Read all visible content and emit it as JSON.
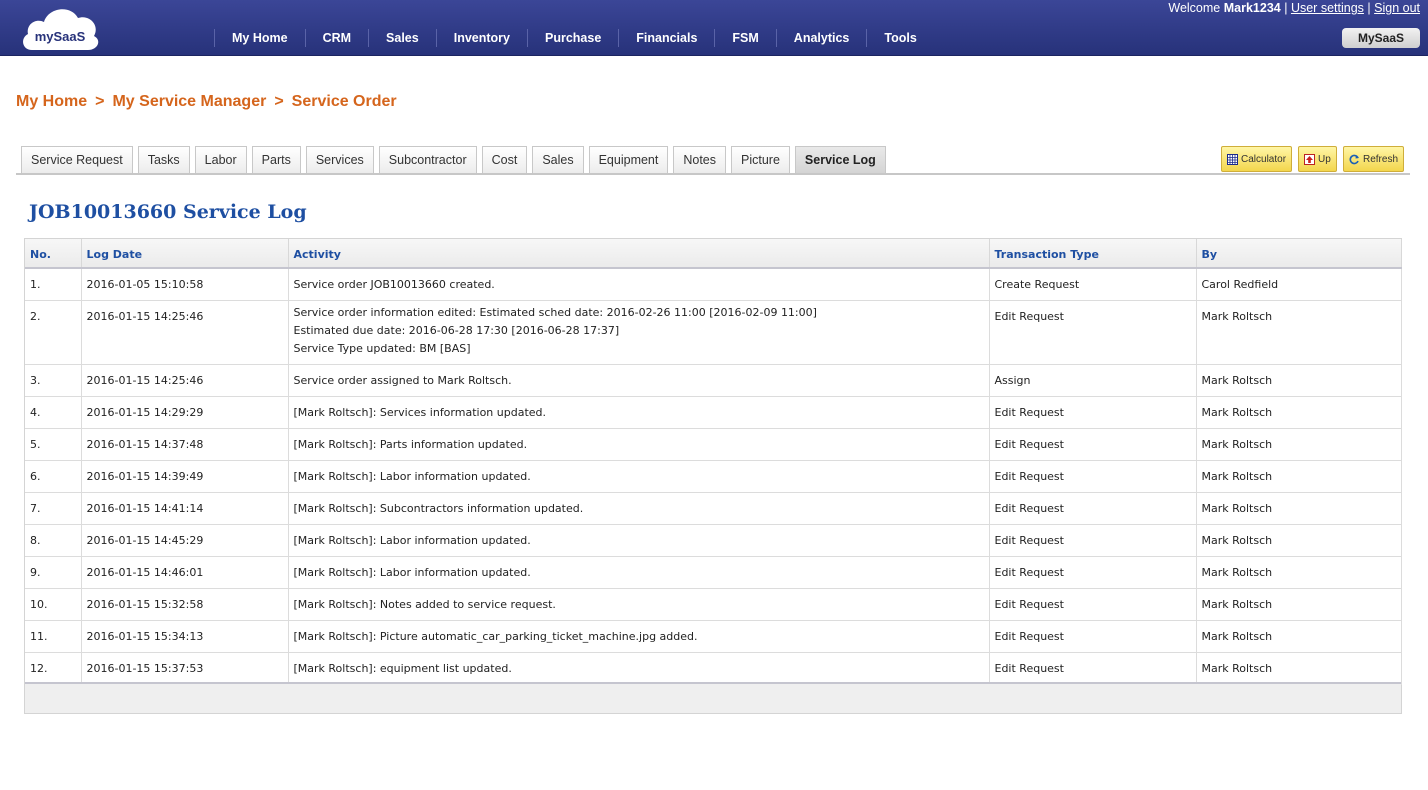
{
  "header": {
    "logo_text": "mySaaS",
    "nav": [
      "My Home",
      "CRM",
      "Sales",
      "Inventory",
      "Purchase",
      "Financials",
      "FSM",
      "Analytics",
      "Tools"
    ],
    "welcome_prefix": "Welcome",
    "username": "Mark1234",
    "separator": "|",
    "user_settings": "User settings",
    "sign_out": "Sign out",
    "mysaas_button": "MySaaS"
  },
  "breadcrumb": {
    "items": [
      "My Home",
      "My Service Manager",
      "Service Order"
    ],
    "separator": ">"
  },
  "tabs": [
    "Service Request",
    "Tasks",
    "Labor",
    "Parts",
    "Services",
    "Subcontractor",
    "Cost",
    "Sales",
    "Equipment",
    "Notes",
    "Picture",
    "Service Log"
  ],
  "active_tab": "Service Log",
  "toolbar": {
    "calculator": "Calculator",
    "up": "Up",
    "refresh": "Refresh"
  },
  "page_title": "JOB10013660 Service Log",
  "table": {
    "columns": [
      "No.",
      "Log Date",
      "Activity",
      "Transaction Type",
      "By"
    ],
    "rows": [
      {
        "no": "1.",
        "date": "2016-01-05 15:10:58",
        "activity": [
          "Service order JOB10013660 created."
        ],
        "type": "Create Request",
        "by": "Carol Redfield"
      },
      {
        "no": "2.",
        "date": "2016-01-15 14:25:46",
        "activity": [
          "Service order information edited: Estimated sched date: 2016-02-26 11:00 [2016-02-09 11:00]",
          "Estimated due date: 2016-06-28 17:30 [2016-06-28 17:37]",
          "Service Type updated: BM [BAS]"
        ],
        "type": "Edit Request",
        "by": "Mark Roltsch"
      },
      {
        "no": "3.",
        "date": "2016-01-15 14:25:46",
        "activity": [
          "Service order assigned to Mark Roltsch."
        ],
        "type": "Assign",
        "by": "Mark Roltsch"
      },
      {
        "no": "4.",
        "date": "2016-01-15 14:29:29",
        "activity": [
          "[Mark Roltsch]: Services information updated."
        ],
        "type": "Edit Request",
        "by": "Mark Roltsch"
      },
      {
        "no": "5.",
        "date": "2016-01-15 14:37:48",
        "activity": [
          "[Mark Roltsch]: Parts information updated."
        ],
        "type": "Edit Request",
        "by": "Mark Roltsch"
      },
      {
        "no": "6.",
        "date": "2016-01-15 14:39:49",
        "activity": [
          "[Mark Roltsch]: Labor information updated."
        ],
        "type": "Edit Request",
        "by": "Mark Roltsch"
      },
      {
        "no": "7.",
        "date": "2016-01-15 14:41:14",
        "activity": [
          "[Mark Roltsch]: Subcontractors information updated."
        ],
        "type": "Edit Request",
        "by": "Mark Roltsch"
      },
      {
        "no": "8.",
        "date": "2016-01-15 14:45:29",
        "activity": [
          "[Mark Roltsch]: Labor information updated."
        ],
        "type": "Edit Request",
        "by": "Mark Roltsch"
      },
      {
        "no": "9.",
        "date": "2016-01-15 14:46:01",
        "activity": [
          "[Mark Roltsch]: Labor information updated."
        ],
        "type": "Edit Request",
        "by": "Mark Roltsch"
      },
      {
        "no": "10.",
        "date": "2016-01-15 15:32:58",
        "activity": [
          "[Mark Roltsch]: Notes added to service request."
        ],
        "type": "Edit Request",
        "by": "Mark Roltsch"
      },
      {
        "no": "11.",
        "date": "2016-01-15 15:34:13",
        "activity": [
          "[Mark Roltsch]: Picture automatic_car_parking_ticket_machine.jpg added."
        ],
        "type": "Edit Request",
        "by": "Mark Roltsch"
      },
      {
        "no": "12.",
        "date": "2016-01-15 15:37:53",
        "activity": [
          "[Mark Roltsch]: equipment list updated."
        ],
        "type": "Edit Request",
        "by": "Mark Roltsch"
      }
    ]
  },
  "colors": {
    "header_bg": "#2f3a86",
    "breadcrumb": "#d5651c",
    "title": "#1e4fa2",
    "column_header": "#1e4fa2",
    "toolbar_button": "#f6e06a"
  }
}
